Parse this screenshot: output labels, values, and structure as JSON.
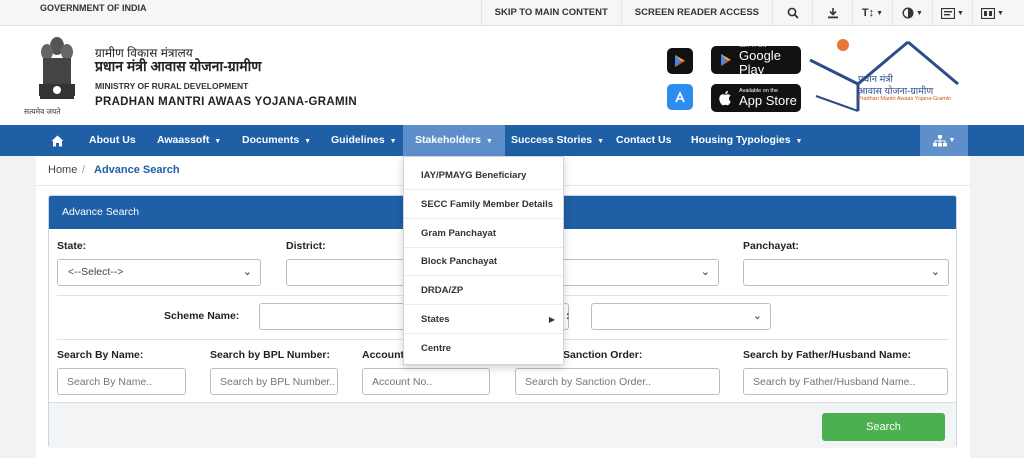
{
  "topbar": {
    "gov_label": "GOVERNMENT OF INDIA",
    "skip_label": "SKIP TO MAIN CONTENT",
    "screen_reader_label": "SCREEN READER ACCESS",
    "icons": [
      "search-icon",
      "download-icon",
      "text-size-icon",
      "contrast-icon",
      "language-icon",
      "keyboard-icon"
    ],
    "text_size_glyph": "T↕"
  },
  "header": {
    "hindi_line1": "ग्रामीण विकास मंत्रालय",
    "hindi_line2": "प्रधान मंत्री आवास योजना-ग्रामीण",
    "english_line1": "MINISTRY OF RURAL DEVELOPMENT",
    "english_line2": "PRADHAN MANTRI AWAAS YOJANA-GRAMIN",
    "emblem_caption": "सत्यमेव जयते",
    "google_play": {
      "small": "GET IT ON",
      "large": "Google Play"
    },
    "app_store": {
      "small": "Available on the",
      "large": "App Store"
    },
    "logo_line1": "प्रधान मंत्री",
    "logo_line2": "आवास योजना-ग्रामीण",
    "logo_line3": "Pradhan Mantri Awaas Yojana-Gramin",
    "colors": {
      "logo_blue": "#2c4d8a",
      "logo_orange": "#e8773a"
    }
  },
  "nav": {
    "items": [
      {
        "label": "About Us"
      },
      {
        "label": "Awaassoft"
      },
      {
        "label": "Documents"
      },
      {
        "label": "Guidelines"
      },
      {
        "label": "Stakeholders",
        "active": true
      },
      {
        "label": "Success Stories"
      },
      {
        "label": "Contact Us"
      },
      {
        "label": "Housing Typologies"
      }
    ],
    "color": "#1f5fa6",
    "active_color": "#5f8fca"
  },
  "breadcrumb": {
    "home": "Home",
    "current": "Advance Search"
  },
  "panel": {
    "title": "Advance Search",
    "state_label": "State:",
    "state_value": "<--Select-->",
    "district_label": "District:",
    "panchayat_label": "Panchayat:",
    "scheme_label": "Scheme Name:",
    "search_name_label": "Search By Name:",
    "search_bpl_label": "Search by BPL Number:",
    "account_label": "Account",
    "sanction_label": "Sanction Order:",
    "father_label": "Search by Father/Husband Name:",
    "placeholders": {
      "name": "Search By Name..",
      "bpl": "Search by BPL Number..",
      "account": "Account No..",
      "sanction": "Search by Sanction Order..",
      "father": "Search by Father/Husband Name.."
    },
    "search_button": "Search",
    "button_color": "#4caf50"
  },
  "dropdown": {
    "items": [
      {
        "label": "IAY/PMAYG Beneficiary"
      },
      {
        "label": "SECC Family Member Details"
      },
      {
        "label": "Gram Panchayat"
      },
      {
        "label": "Block Panchayat"
      },
      {
        "label": "DRDA/ZP"
      },
      {
        "label": "States",
        "has_submenu": true
      },
      {
        "label": "Centre"
      }
    ]
  }
}
